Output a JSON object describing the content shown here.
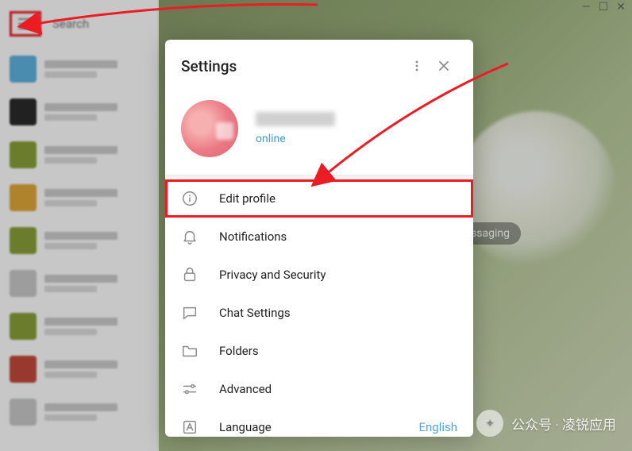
{
  "window": {
    "search_placeholder": "Search"
  },
  "settings": {
    "title": "Settings",
    "status": "online",
    "items": {
      "edit_profile": "Edit profile",
      "notifications": "Notifications",
      "privacy": "Privacy and Security",
      "chat": "Chat Settings",
      "folders": "Folders",
      "advanced": "Advanced",
      "language": "Language",
      "language_value": "English"
    }
  },
  "background": {
    "pill_text": "ssaging"
  },
  "chat_colors": [
    "#5fb3e0",
    "#2b2b2b",
    "#8aa13a",
    "#e0a838",
    "#8aa13a",
    "#c9c9c9",
    "#8aa13a",
    "#c24a3a",
    "#c9c9c9"
  ],
  "watermark": "公众号 · 凌锐应用"
}
